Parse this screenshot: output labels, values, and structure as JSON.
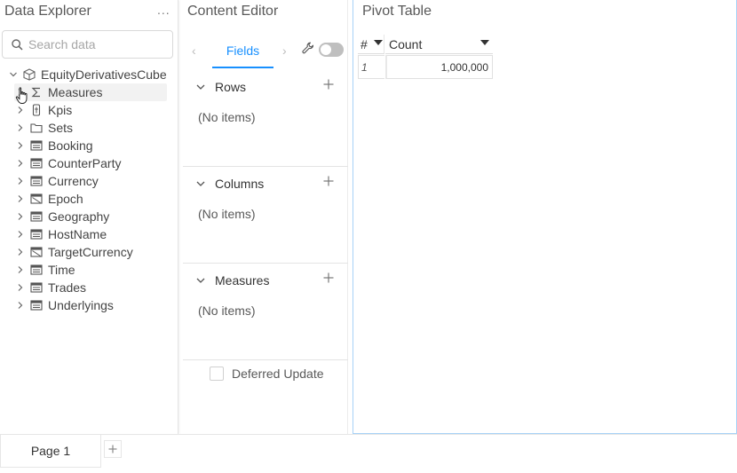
{
  "data_explorer": {
    "title": "Data Explorer",
    "more": "...",
    "search_placeholder": "Search data",
    "cube": {
      "label": "EquityDerivativesCube",
      "icon": "cube-icon"
    },
    "items": [
      {
        "label": "Measures",
        "icon": "sigma-icon",
        "selected": true
      },
      {
        "label": "Kpis",
        "icon": "kpi-icon"
      },
      {
        "label": "Sets",
        "icon": "folder-icon"
      },
      {
        "label": "Booking",
        "icon": "dimension-icon"
      },
      {
        "label": "CounterParty",
        "icon": "dimension-icon"
      },
      {
        "label": "Currency",
        "icon": "dimension-icon"
      },
      {
        "label": "Epoch",
        "icon": "analytic-dimension-icon"
      },
      {
        "label": "Geography",
        "icon": "dimension-icon"
      },
      {
        "label": "HostName",
        "icon": "dimension-icon"
      },
      {
        "label": "TargetCurrency",
        "icon": "analytic-dimension-icon"
      },
      {
        "label": "Time",
        "icon": "dimension-icon"
      },
      {
        "label": "Trades",
        "icon": "dimension-icon"
      },
      {
        "label": "Underlyings",
        "icon": "dimension-icon"
      }
    ]
  },
  "content_editor": {
    "title": "Content Editor",
    "tab_label": "Fields",
    "sections": [
      {
        "label": "Rows",
        "empty_text": "(No items)"
      },
      {
        "label": "Columns",
        "empty_text": "(No items)"
      },
      {
        "label": "Measures",
        "empty_text": "(No items)"
      }
    ],
    "deferred_update_label": "Deferred Update"
  },
  "pivot_table": {
    "title": "Pivot Table",
    "headers": {
      "index": "#",
      "count": "Count"
    },
    "rows": [
      {
        "index": "1",
        "count": "1,000,000"
      }
    ]
  },
  "pages": {
    "tabs": [
      "Page 1"
    ],
    "add_symbol": "+"
  },
  "colors": {
    "accent": "#1890ff",
    "pivot_border": "#a7d2f7"
  }
}
